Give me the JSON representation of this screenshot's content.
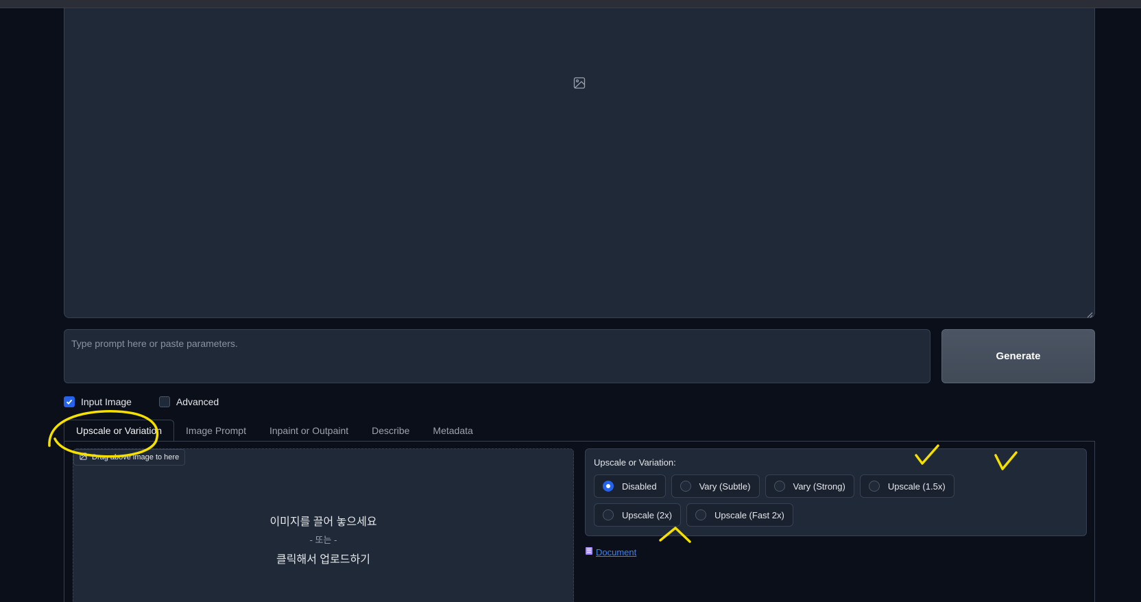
{
  "prompt": {
    "placeholder": "Type prompt here or paste parameters.",
    "value": ""
  },
  "generate_label": "Generate",
  "checkboxes": {
    "input_image": {
      "label": "Input Image",
      "checked": true
    },
    "advanced": {
      "label": "Advanced",
      "checked": false
    }
  },
  "tabs": [
    {
      "label": "Upscale or Variation",
      "active": true
    },
    {
      "label": "Image Prompt",
      "active": false
    },
    {
      "label": "Inpaint or Outpaint",
      "active": false
    },
    {
      "label": "Describe",
      "active": false
    },
    {
      "label": "Metadata",
      "active": false
    }
  ],
  "dropzone": {
    "drag_label": "Drag above image to here",
    "line1": "이미지를 끌어 놓으세요",
    "line2": "- 또는 -",
    "line3": "클릭해서 업로드하기"
  },
  "upscale": {
    "label": "Upscale or Variation:",
    "options": [
      {
        "label": "Disabled",
        "selected": true
      },
      {
        "label": "Vary (Subtle)",
        "selected": false
      },
      {
        "label": "Vary (Strong)",
        "selected": false
      },
      {
        "label": "Upscale (1.5x)",
        "selected": false
      },
      {
        "label": "Upscale (2x)",
        "selected": false
      },
      {
        "label": "Upscale (Fast 2x)",
        "selected": false
      }
    ]
  },
  "document_link": "Document",
  "colors": {
    "background": "#0b0f19",
    "panel": "#1f2937",
    "accent": "#2563eb",
    "annotation": "#f5e000"
  }
}
